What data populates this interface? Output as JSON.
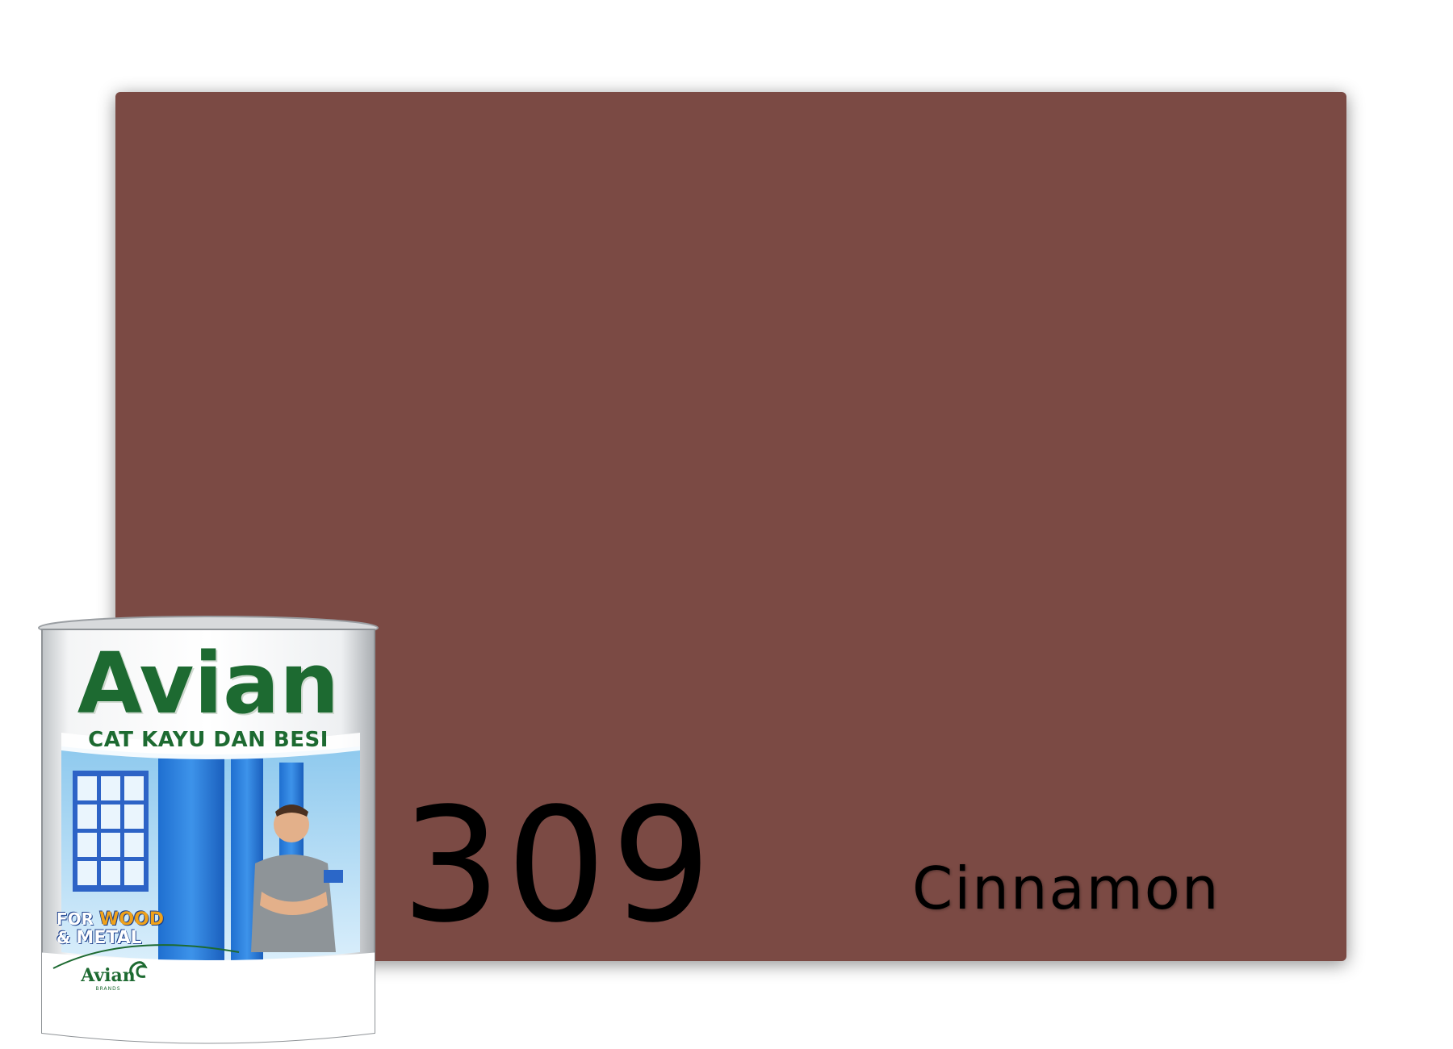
{
  "swatch": {
    "color": "#7b4a44",
    "code": "309",
    "name": "Cinnamon"
  },
  "product": {
    "brand": "Avian",
    "subtitle": "CAT KAYU DAN BESI",
    "for_label": "FOR",
    "wood_label": "WOOD",
    "amp_label": "&",
    "metal_label": "METAL",
    "logo_text": "Avian",
    "logo_small": "BRANDS",
    "brand_color": "#1d6a31"
  }
}
